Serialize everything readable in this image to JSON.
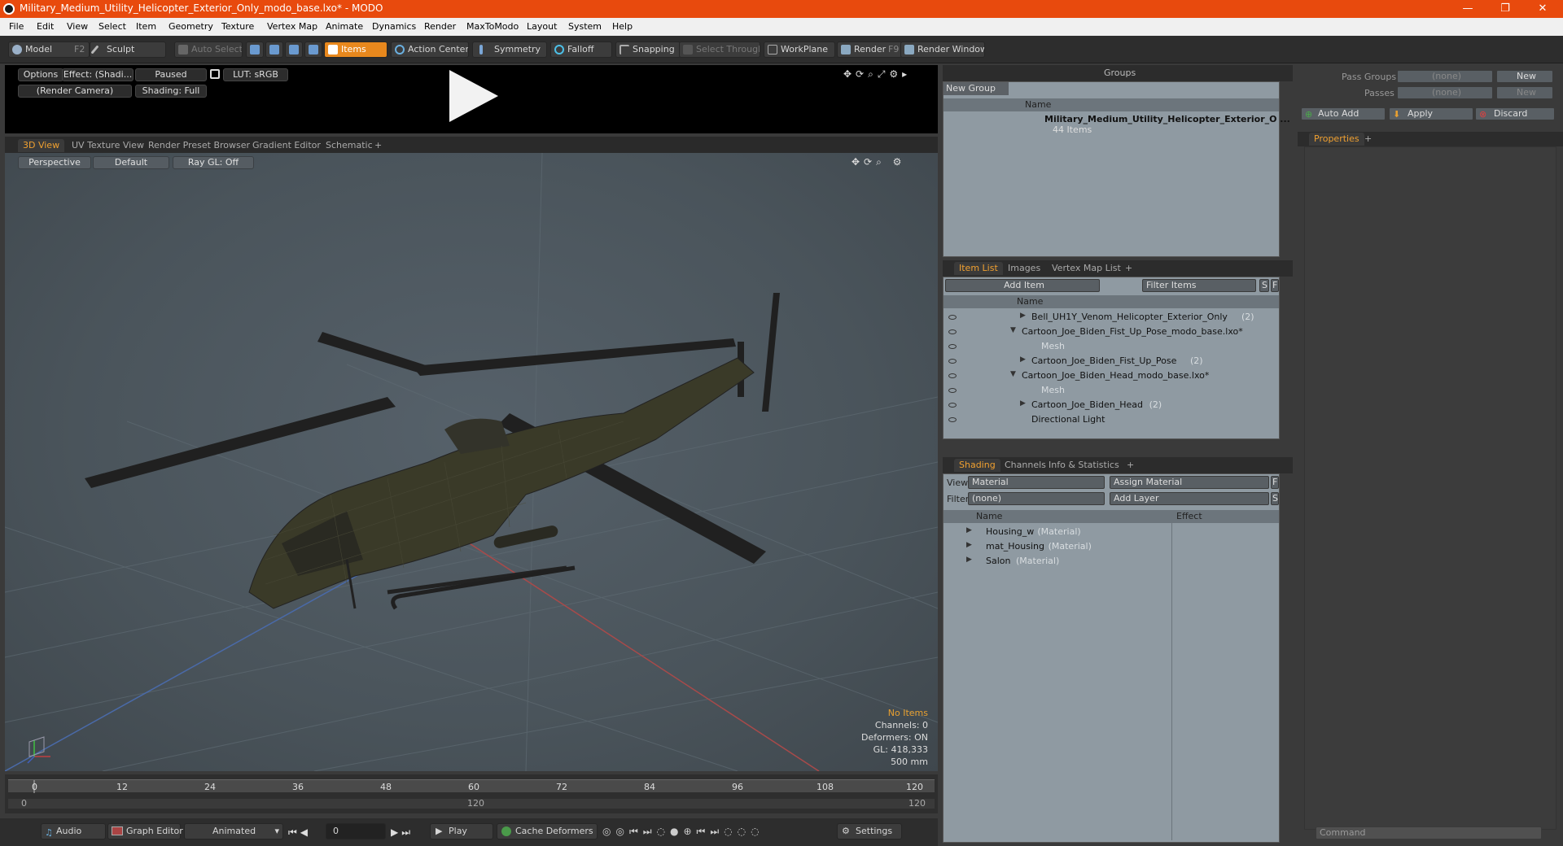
{
  "window": {
    "title": "Military_Medium_Utility_Helicopter_Exterior_Only_modo_base.lxo* - MODO",
    "minimize": "—",
    "restore": "❐",
    "close": "✕"
  },
  "menu": [
    "File",
    "Edit",
    "View",
    "Select",
    "Item",
    "Geometry",
    "Texture",
    "Vertex Map",
    "Animate",
    "Dynamics",
    "Render",
    "MaxToModo",
    "Layout",
    "System",
    "Help"
  ],
  "toolbar": {
    "model": "Model",
    "model_key": "F2",
    "sculpt": "Sculpt",
    "auto_select": "Auto Select",
    "items": "Items",
    "action_center": "Action Center",
    "symmetry": "Symmetry",
    "falloff": "Falloff",
    "snapping": "Snapping",
    "select_through": "Select Through",
    "workplane": "WorkPlane",
    "render": "Render",
    "render_key": "F9",
    "render_window": "Render Window"
  },
  "preview": {
    "options": "Options",
    "effect": "Effect: (Shadi...",
    "paused": "Paused",
    "lut": "LUT: sRGB",
    "camera": "(Render Camera)",
    "shading": "Shading: Full"
  },
  "view_tabs": [
    "3D View",
    "UV Texture View",
    "Render Preset Browser",
    "Gradient Editor",
    "Schematic",
    "+"
  ],
  "viewport": {
    "perspective": "Perspective",
    "default": "Default",
    "raygl": "Ray GL: Off",
    "stats": {
      "no_items": "No Items",
      "channels": "Channels: 0",
      "deformers": "Deformers: ON",
      "gl": "GL: 418,333",
      "scale": "500 mm"
    }
  },
  "timeline": {
    "ticks": [
      "0",
      "12",
      "24",
      "36",
      "48",
      "60",
      "72",
      "84",
      "96",
      "108",
      "120"
    ],
    "range_start": "0",
    "range_mid": "120",
    "range_end": "120"
  },
  "bottombar": {
    "audio": "Audio",
    "graph_editor": "Graph Editor",
    "animated": "Animated",
    "frame": "0",
    "play": "Play",
    "cache_deformers": "Cache Deformers",
    "settings": "Settings"
  },
  "groups": {
    "title": "Groups",
    "new_group": "New Group",
    "col_name": "Name",
    "item_name": "Military_Medium_Utility_Helicopter_Exterior_O ...",
    "item_count": "44 Items"
  },
  "item_list": {
    "tabs": [
      "Item List",
      "Images",
      "Vertex Map List",
      "+"
    ],
    "add_item": "Add Item",
    "filter": "Filter Items",
    "s": "S",
    "f": "F",
    "col_name": "Name",
    "rows": [
      {
        "name": "Bell_UH1Y_Venom_Helicopter_Exterior_Only",
        "suffix": "(2)",
        "indent": 1,
        "arrow": "▶"
      },
      {
        "name": "Cartoon_Joe_Biden_Fist_Up_Pose_modo_base.lxo*",
        "suffix": "",
        "indent": 0,
        "arrow": "▼"
      },
      {
        "name": "Mesh",
        "suffix": "",
        "indent": 2,
        "arrow": ""
      },
      {
        "name": "Cartoon_Joe_Biden_Fist_Up_Pose",
        "suffix": "(2)",
        "indent": 1,
        "arrow": "▶"
      },
      {
        "name": "Cartoon_Joe_Biden_Head_modo_base.lxo*",
        "suffix": "",
        "indent": 0,
        "arrow": "▼"
      },
      {
        "name": "Mesh",
        "suffix": "",
        "indent": 2,
        "arrow": ""
      },
      {
        "name": "Cartoon_Joe_Biden_Head",
        "suffix": "(2)",
        "indent": 1,
        "arrow": "▶"
      },
      {
        "name": "Directional Light",
        "suffix": "",
        "indent": 1,
        "arrow": ""
      }
    ]
  },
  "shading": {
    "tabs": [
      "Shading",
      "Channels",
      "Info & Statistics",
      "+"
    ],
    "view_label": "View",
    "view_value": "Material",
    "assign_material": "Assign Material",
    "f": "F",
    "filter_label": "Filter",
    "filter_value": "(none)",
    "add_layer": "Add Layer",
    "s": "S",
    "col_name": "Name",
    "col_effect": "Effect",
    "rows": [
      {
        "name": "Housing_w",
        "type": "(Material)"
      },
      {
        "name": "mat_Housing",
        "type": "(Material)"
      },
      {
        "name": "Salon",
        "type": "(Material)"
      }
    ]
  },
  "properties": {
    "pass_groups_label": "Pass Groups",
    "pass_groups_value": "(none)",
    "new": "New",
    "passes_label": "Passes",
    "passes_value": "(none)",
    "new2": "New",
    "auto_add": "Auto Add",
    "apply": "Apply",
    "discard": "Discard",
    "tab": "Properties",
    "plus": "+",
    "command": "Command"
  },
  "colors": {
    "accent": "#e8881d",
    "titlebar": "#e84a0d",
    "viewport": "#4e585f",
    "panel": "#8f9aa2"
  }
}
